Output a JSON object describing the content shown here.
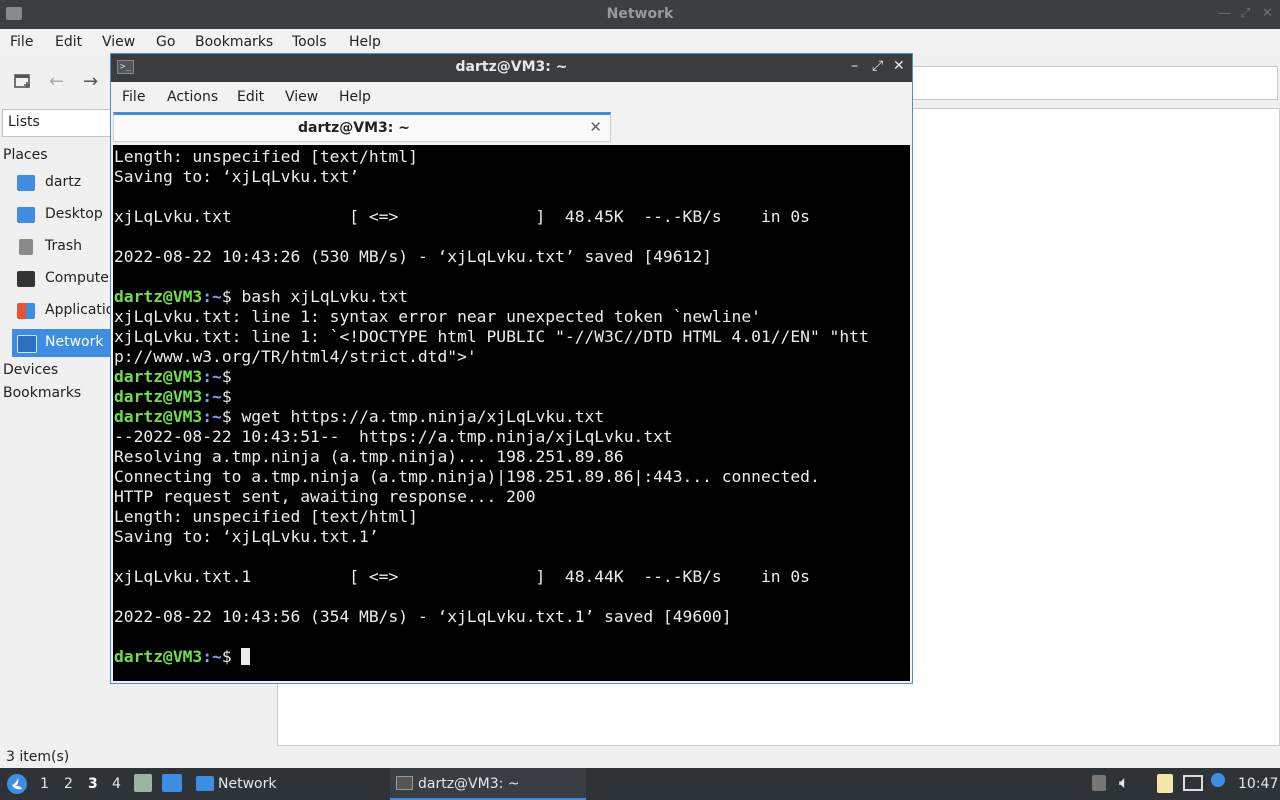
{
  "file_manager": {
    "title": "Network",
    "menu": [
      "File",
      "Edit",
      "View",
      "Go",
      "Bookmarks",
      "Tools",
      "Help"
    ],
    "side_pane_mode": "Lists",
    "places_heading": "Places",
    "places": [
      {
        "label": "dartz",
        "icon": "home-folder-icon",
        "color": "#3d8ee2"
      },
      {
        "label": "Desktop",
        "icon": "desktop-icon",
        "color": "#3d8ee2"
      },
      {
        "label": "Trash",
        "icon": "trash-icon",
        "color": "#7a7a7a"
      },
      {
        "label": "Computer",
        "icon": "computer-icon",
        "color": "#333333"
      },
      {
        "label": "Applications",
        "icon": "applications-icon",
        "color": "#e8542f"
      },
      {
        "label": "Network",
        "icon": "network-icon",
        "color": "#2a6fc0"
      }
    ],
    "devices_heading": "Devices",
    "bookmarks_heading": "Bookmarks",
    "status": "3 item(s)"
  },
  "terminal": {
    "title": "dartz@VM3: ~",
    "menu": [
      "File",
      "Actions",
      "Edit",
      "View",
      "Help"
    ],
    "tab_label": "dartz@VM3: ~",
    "prompt_user": "dartz@VM3",
    "prompt_path": ":~",
    "lines": [
      {
        "t": "Length: unspecified [text/html]"
      },
      {
        "t": "Saving to: ‘xjLqLvku.txt’"
      },
      {
        "t": ""
      },
      {
        "t": "xjLqLvku.txt            [ <=>              ]  48.45K  --.-KB/s    in 0s"
      },
      {
        "t": ""
      },
      {
        "t": "2022-08-22 10:43:26 (530 MB/s) - ‘xjLqLvku.txt’ saved [49612]"
      },
      {
        "t": ""
      },
      {
        "p": true,
        "t": "$ bash xjLqLvku.txt"
      },
      {
        "t": "xjLqLvku.txt: line 1: syntax error near unexpected token `newline'"
      },
      {
        "t": "xjLqLvku.txt: line 1: `<!DOCTYPE html PUBLIC \"-//W3C//DTD HTML 4.01//EN\" \"htt"
      },
      {
        "t": "p://www.w3.org/TR/html4/strict.dtd\">'"
      },
      {
        "p": true,
        "t": "$"
      },
      {
        "p": true,
        "t": "$"
      },
      {
        "p": true,
        "t": "$ wget https://a.tmp.ninja/xjLqLvku.txt"
      },
      {
        "t": "--2022-08-22 10:43:51--  https://a.tmp.ninja/xjLqLvku.txt"
      },
      {
        "t": "Resolving a.tmp.ninja (a.tmp.ninja)... 198.251.89.86"
      },
      {
        "t": "Connecting to a.tmp.ninja (a.tmp.ninja)|198.251.89.86|:443... connected."
      },
      {
        "t": "HTTP request sent, awaiting response... 200"
      },
      {
        "t": "Length: unspecified [text/html]"
      },
      {
        "t": "Saving to: ‘xjLqLvku.txt.1’"
      },
      {
        "t": ""
      },
      {
        "t": "xjLqLvku.txt.1          [ <=>              ]  48.44K  --.-KB/s    in 0s"
      },
      {
        "t": ""
      },
      {
        "t": "2022-08-22 10:43:56 (354 MB/s) - ‘xjLqLvku.txt.1’ saved [49600]"
      },
      {
        "t": ""
      },
      {
        "p": true,
        "t": "$ ",
        "cursor": true
      }
    ]
  },
  "taskbar": {
    "workspaces": [
      "1",
      "2",
      "3",
      "4"
    ],
    "active_workspace": "3",
    "tasks": [
      {
        "label": "Network",
        "icon": "folder-icon"
      },
      {
        "label": "dartz@VM3: ~",
        "icon": "terminal-icon"
      }
    ],
    "clock": "10:47"
  }
}
